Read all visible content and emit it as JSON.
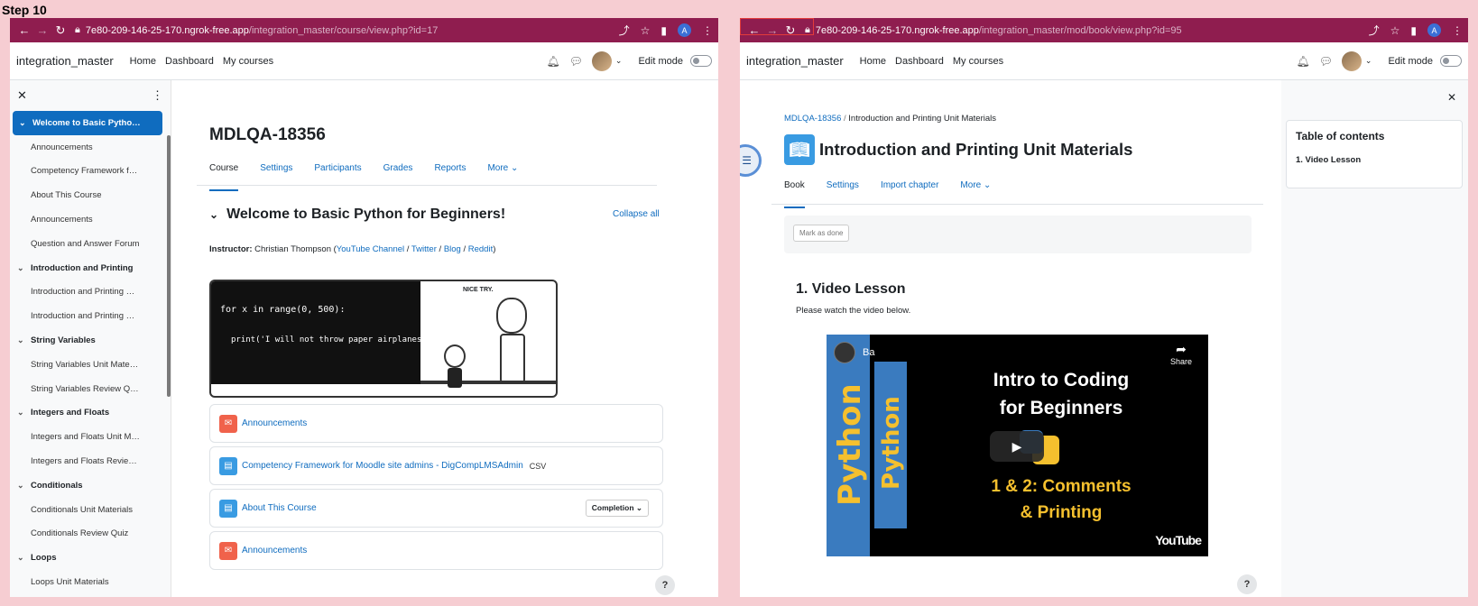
{
  "step_label": "Step 10",
  "left": {
    "url_host": "7e80-209-146-25-170.ngrok-free.app",
    "url_path": "/integration_master/course/view.php?id=17",
    "avatar_letter": "A",
    "brand": "integration_master",
    "nav": [
      "Home",
      "Dashboard",
      "My courses"
    ],
    "edit_mode": "Edit mode",
    "drawer": [
      {
        "label": "Welcome to Basic Pytho…",
        "type": "section",
        "active": true
      },
      {
        "label": "Announcements",
        "type": "item"
      },
      {
        "label": "Competency Framework f…",
        "type": "item"
      },
      {
        "label": "About This Course",
        "type": "item"
      },
      {
        "label": "Announcements",
        "type": "item"
      },
      {
        "label": "Question and Answer Forum",
        "type": "item"
      },
      {
        "label": "Introduction and Printing",
        "type": "section"
      },
      {
        "label": "Introduction and Printing …",
        "type": "item"
      },
      {
        "label": "Introduction and Printing …",
        "type": "item"
      },
      {
        "label": "String Variables",
        "type": "section"
      },
      {
        "label": "String Variables Unit Mate…",
        "type": "item"
      },
      {
        "label": "String Variables Review Q…",
        "type": "item"
      },
      {
        "label": "Integers and Floats",
        "type": "section"
      },
      {
        "label": "Integers and Floats Unit M…",
        "type": "item"
      },
      {
        "label": "Integers and Floats Revie…",
        "type": "item"
      },
      {
        "label": "Conditionals",
        "type": "section"
      },
      {
        "label": "Conditionals Unit Materials",
        "type": "item"
      },
      {
        "label": "Conditionals Review Quiz",
        "type": "item"
      },
      {
        "label": "Loops",
        "type": "section"
      },
      {
        "label": "Loops Unit Materials",
        "type": "item"
      }
    ],
    "course_title": "MDLQA-18356",
    "tabs": [
      "Course",
      "Settings",
      "Participants",
      "Grades",
      "Reports",
      "More ⌄"
    ],
    "section_title": "Welcome to Basic Python for Beginners!",
    "collapse_all": "Collapse all",
    "instructor_label": "Instructor:",
    "instructor_name": "Christian Thompson (",
    "links": [
      "YouTube Channel",
      "Twitter",
      "Blog",
      "Reddit"
    ],
    "comic": {
      "line1": "for x in range(0, 500):",
      "line2": "print('I will not throw paper airplanes in class.')",
      "caption": "NICE TRY."
    },
    "activities": [
      {
        "label": "Announcements",
        "icon": "red",
        "extra": ""
      },
      {
        "label": "Competency Framework for Moodle site admins - DigCompLMSAdmin",
        "icon": "blue",
        "extra": "CSV"
      },
      {
        "label": "About This Course",
        "icon": "blue",
        "extra": "",
        "completion": "Completion ⌄"
      },
      {
        "label": "Announcements",
        "icon": "red",
        "extra": ""
      }
    ],
    "help": "?"
  },
  "right": {
    "url_host": "7e80-209-146-25-170.ngrok-free.app",
    "url_path": "/integration_master/mod/book/view.php?id=95",
    "avatar_letter": "A",
    "brand": "integration_master",
    "nav": [
      "Home",
      "Dashboard",
      "My courses"
    ],
    "edit_mode": "Edit mode",
    "breadcrumb": [
      "MDLQA-18356",
      "Introduction and Printing Unit Materials"
    ],
    "title": "Introduction and Printing Unit Materials",
    "tabs": [
      "Book",
      "Settings",
      "Import chapter",
      "More ⌄"
    ],
    "mark_done": "Mark as done",
    "chapter_title": "1. Video Lesson",
    "chapter_text": "Please watch the video below.",
    "video": {
      "strip1": "Python",
      "strip2": "Python",
      "title_line1": "Intro to Coding",
      "title_line2": "for Beginners",
      "sub_line1": "1 & 2: Comments",
      "sub_line2": "& Printing",
      "share": "Share",
      "channel": "Ba",
      "youtube": "YouTube"
    },
    "toc_title": "Table of contents",
    "toc_items": [
      "1. Video Lesson"
    ],
    "help": "?"
  }
}
